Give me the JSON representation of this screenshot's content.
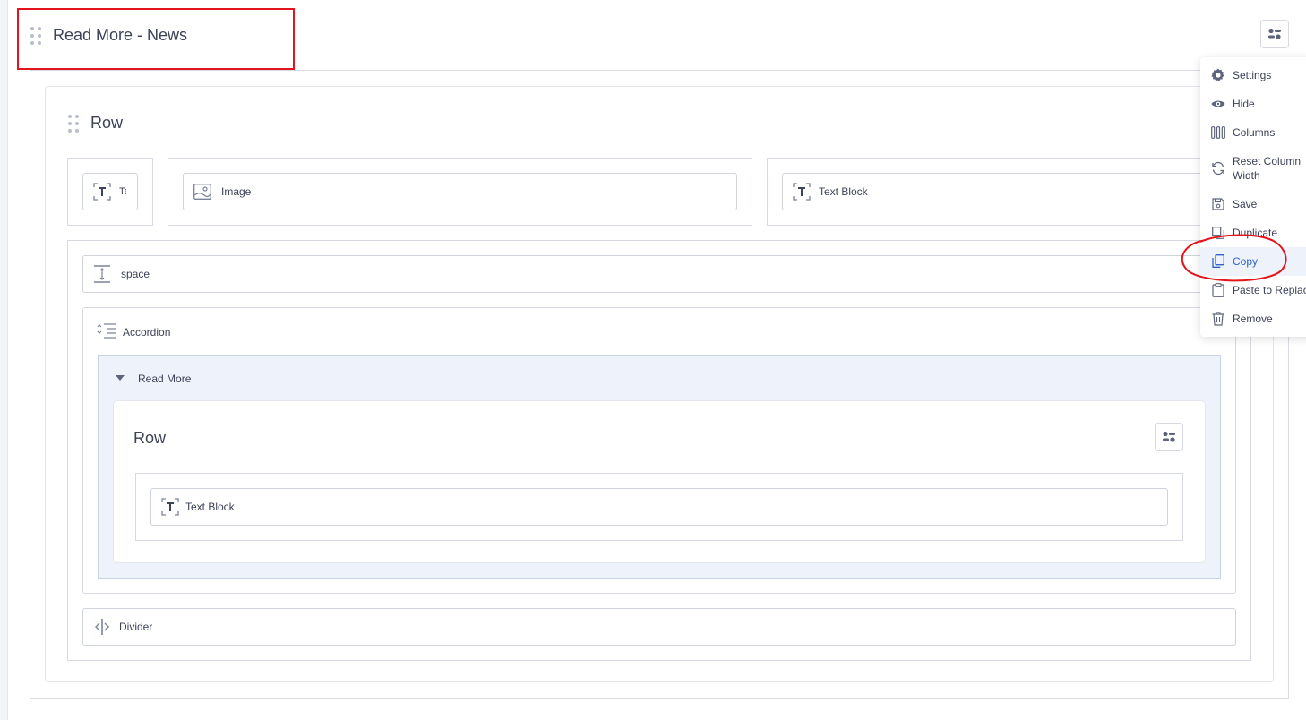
{
  "section": {
    "title": "Read More - News"
  },
  "outer_row": {
    "title": "Row",
    "columns": [
      {
        "element": {
          "label": "Te",
          "icon": "text-block-icon"
        }
      },
      {
        "element": {
          "label": "Image",
          "icon": "image-icon"
        }
      },
      {
        "element": {
          "label": "Text Block",
          "icon": "text-block-icon"
        }
      }
    ]
  },
  "stack": {
    "space": {
      "label": "space",
      "icon": "spacer-icon"
    },
    "accordion": {
      "label": "Accordion",
      "icon": "accordion-icon",
      "panel": {
        "label": "Read More",
        "row": {
          "title": "Row",
          "element": {
            "label": "Text Block",
            "icon": "text-block-icon"
          }
        }
      }
    },
    "divider": {
      "label": "Divider",
      "icon": "divider-icon"
    }
  },
  "context_menu": {
    "items": [
      {
        "label": "Settings",
        "icon": "gear-icon"
      },
      {
        "label": "Hide",
        "icon": "eye-icon"
      },
      {
        "label": "Columns",
        "icon": "columns-icon"
      },
      {
        "label": "Reset Column Width",
        "icon": "reset-icon"
      },
      {
        "label": "Save",
        "icon": "save-icon"
      },
      {
        "label": "Duplicate",
        "icon": "duplicate-icon"
      },
      {
        "label": "Copy",
        "icon": "copy-icon"
      },
      {
        "label": "Paste to Replace",
        "icon": "clipboard-icon"
      },
      {
        "label": "Remove",
        "icon": "trash-icon"
      }
    ],
    "active_item": "Copy"
  },
  "annotations": {
    "highlight_color": "#e3141b",
    "accent_color": "#2f62c9"
  }
}
